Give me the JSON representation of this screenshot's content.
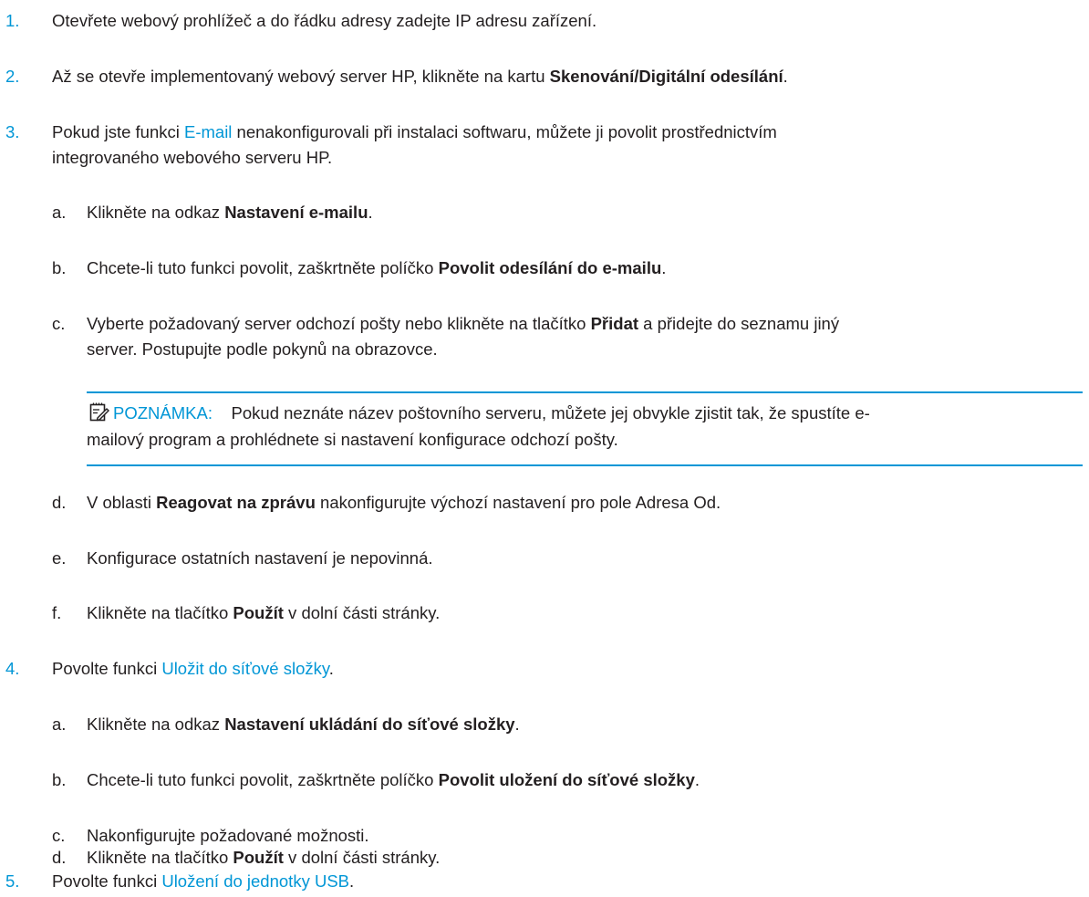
{
  "steps": {
    "s1": {
      "num": "1.",
      "text": "Otevřete webový prohlížeč a do řádku adresy zadejte IP adresu zařízení."
    },
    "s2": {
      "num": "2.",
      "pre": "Až se otevře implementovaný webový server HP, klikněte na kartu ",
      "kw": "Skenování/Digitální odesílání",
      "post": "."
    },
    "s3": {
      "num": "3.",
      "pre": "Pokud jste funkci ",
      "link": "E-mail",
      "post": " nenakonfigurovali při instalaci softwaru, můžete ji povolit prostřednictvím",
      "line2": "integrovaného webového serveru HP."
    },
    "s3a": {
      "letter": "a.",
      "pre": "Klikněte na odkaz ",
      "kw": "Nastavení e-mailu",
      "post": "."
    },
    "s3b": {
      "letter": "b.",
      "pre": "Chcete-li tuto funkci povolit, zaškrtněte políčko ",
      "kw": "Povolit odesílání do e-mailu",
      "post": "."
    },
    "s3c": {
      "letter": "c.",
      "pre": "Vyberte požadovaný server odchozí pošty nebo klikněte na tlačítko ",
      "kw": "Přidat",
      "post": " a přidejte do seznamu jiný",
      "line2": "server. Postupujte podle pokynů na obrazovce."
    },
    "note": {
      "label": "POZNÁMKA:",
      "text": "Pokud neznáte název poštovního serveru, můžete jej obvykle zjistit tak, že spustíte e-",
      "line2": "mailový program a prohlédnete si nastavení konfigurace odchozí pošty."
    },
    "s3d": {
      "letter": "d.",
      "pre": "V oblasti ",
      "kw": "Reagovat na zprávu",
      "post": " nakonfigurujte výchozí nastavení pro pole Adresa Od."
    },
    "s3e": {
      "letter": "e.",
      "text": "Konfigurace ostatních nastavení je nepovinná."
    },
    "s3f": {
      "letter": "f.",
      "pre": "Klikněte na tlačítko ",
      "kw": "Použít",
      "post": " v dolní části stránky."
    },
    "s4": {
      "num": "4.",
      "pre": "Povolte funkci ",
      "link": "Uložit do síťové složky",
      "post": "."
    },
    "s4a": {
      "letter": "a.",
      "pre": "Klikněte na odkaz ",
      "kw": "Nastavení ukládání do síťové složky",
      "post": "."
    },
    "s4b": {
      "letter": "b.",
      "pre": "Chcete-li tuto funkci povolit, zaškrtněte políčko ",
      "kw": "Povolit uložení do síťové složky",
      "post": "."
    },
    "s4c": {
      "letter": "c.",
      "text": "Nakonfigurujte požadované možnosti."
    },
    "s4d": {
      "letter": "d.",
      "pre": "Klikněte na tlačítko ",
      "kw": "Použít",
      "post": " v dolní části stránky."
    },
    "s5": {
      "num": "5.",
      "pre": "Povolte funkci ",
      "link": "Uložení do jednotky USB",
      "post": "."
    }
  },
  "colors": {
    "accent": "#0096d6",
    "text": "#231f20"
  },
  "icons": {
    "note": "note-pencil-icon"
  }
}
